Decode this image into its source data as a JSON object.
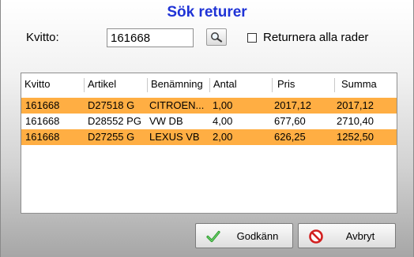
{
  "dialog": {
    "title": "Sök returer",
    "kvitto_label": "Kvitto:",
    "kvitto_value": "161668",
    "search_icon": "magnifier-icon",
    "return_all_label": "Returnera alla rader",
    "return_all_checked": false
  },
  "table": {
    "columns": [
      "Kvitto",
      "Artikel",
      "Benämning",
      "Antal",
      "Pris",
      "Summa"
    ],
    "rows": [
      {
        "kvitto": "161668",
        "artikel": "D27518 G",
        "benamning": "CITROEN...",
        "antal": "1,00",
        "pris": "2017,12",
        "summa": "2017,12",
        "selected": true
      },
      {
        "kvitto": "161668",
        "artikel": "D28552 PG",
        "benamning": "VW DB",
        "antal": "4,00",
        "pris": "677,60",
        "summa": "2710,40",
        "selected": false
      },
      {
        "kvitto": "161668",
        "artikel": "D27255 G",
        "benamning": "LEXUS VB",
        "antal": "2,00",
        "pris": "626,25",
        "summa": "1252,50",
        "selected": true
      }
    ]
  },
  "buttons": {
    "ok_label": "Godkänn",
    "ok_icon": "checkmark-icon",
    "cancel_label": "Avbryt",
    "cancel_icon": "no-entry-icon"
  },
  "colors": {
    "title": "#1f33d6",
    "selected_row": "#ffae43"
  }
}
